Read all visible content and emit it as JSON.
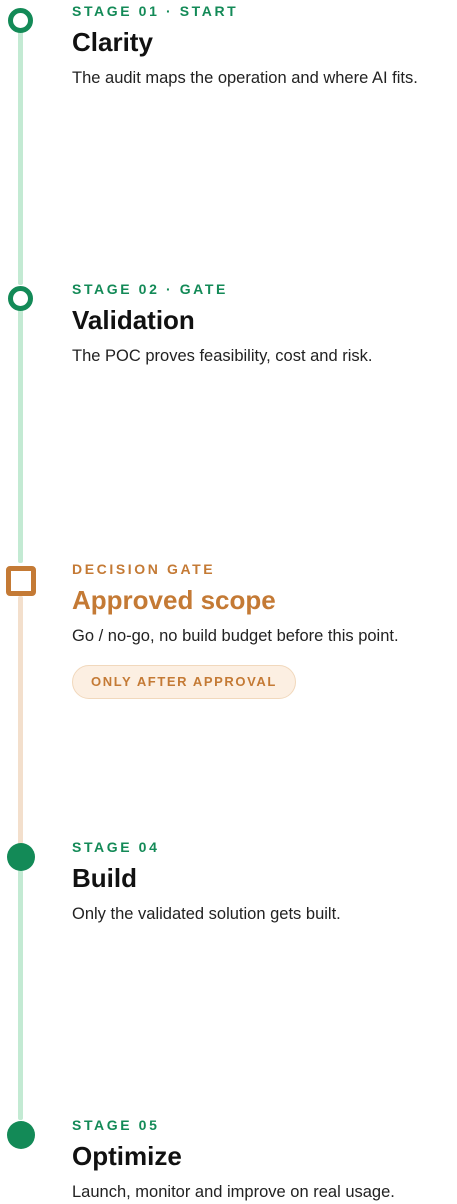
{
  "stages": [
    {
      "eyebrow": "STAGE 01 · START",
      "title": "Clarity",
      "description": "The audit maps the operation and where AI fits.",
      "marker": "ring-icon"
    },
    {
      "eyebrow": "STAGE 02 · GATE",
      "title": "Validation",
      "description": "The POC proves feasibility, cost and risk.",
      "marker": "ring-icon"
    },
    {
      "eyebrow": "DECISION GATE",
      "title": "Approved scope",
      "description": "Go / no-go, no build budget before this point.",
      "badge": "ONLY AFTER APPROVAL",
      "marker": "square-icon"
    },
    {
      "eyebrow": "STAGE 04",
      "title": "Build",
      "description": "Only the validated solution gets built.",
      "marker": "filled-dot-icon"
    },
    {
      "eyebrow": "STAGE 05",
      "title": "Optimize",
      "description": "Launch, monitor and improve on real usage.",
      "marker": "filled-dot-icon"
    }
  ],
  "colors": {
    "green": "#138a57",
    "green_line": "#c3ead3",
    "gate_accent": "#c47a35",
    "gate_line": "#f3dfcc",
    "badge_bg": "#fcefe2"
  }
}
